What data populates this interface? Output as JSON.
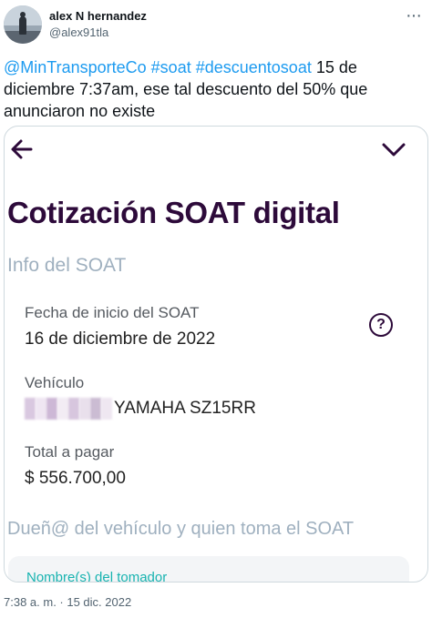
{
  "tweet": {
    "author_name": "alex N hernandez",
    "author_handle": "@alex91tla",
    "text_parts": {
      "mention": "@MinTransporteCo",
      "hashtag1": "#soat",
      "hashtag2": "#descuentosoat",
      "body": " 15 de diciembre 7:37am, ese tal descuento del 50% que anunciaron no existe"
    },
    "timestamp": "7:38 a. m. · 15 dic. 2022"
  },
  "screenshot": {
    "title": "Cotización SOAT digital",
    "section_title": "Info del SOAT",
    "fields": [
      {
        "label": "Fecha de inicio del SOAT",
        "value": "16 de diciembre de 2022"
      },
      {
        "label": "Vehículo",
        "value": "YAMAHA SZ15RR"
      },
      {
        "label": "Total a pagar",
        "value": "$ 556.700,00"
      }
    ],
    "owner_section_title": "Dueñ@ del vehículo y quien toma el SOAT",
    "tomador_label": "Nombre(s) del tomador",
    "help_glyph": "?"
  },
  "colors": {
    "link": "#1d9bf0",
    "title_purple": "#2d0a3a",
    "section_gray": "#9fb0bf",
    "teal": "#17b3b0"
  },
  "icons": {
    "back": "arrow-left-icon",
    "collapse": "chevron-down-icon",
    "help": "question-circle-icon",
    "more": "more-dots-icon"
  }
}
